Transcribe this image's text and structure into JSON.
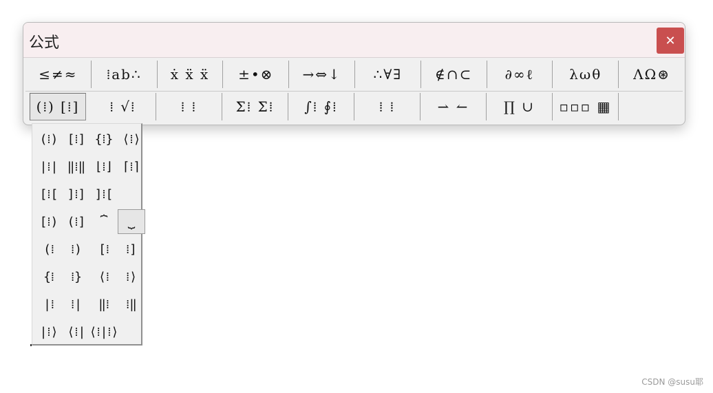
{
  "window": {
    "title": "公式",
    "close_label": "✕"
  },
  "toolbar": {
    "row1": [
      {
        "name": "relations-palette",
        "label": "≤≠≈"
      },
      {
        "name": "spaces-ellipses-palette",
        "label": "⁞ab∴"
      },
      {
        "name": "embellishments-palette",
        "label": "ẋ ẍ ẍ"
      },
      {
        "name": "operators-palette",
        "label": "±•⊗"
      },
      {
        "name": "arrows-palette",
        "label": "→⇔↓"
      },
      {
        "name": "logic-palette",
        "label": "∴∀∃"
      },
      {
        "name": "set-theory-palette",
        "label": "∉∩⊂"
      },
      {
        "name": "misc-symbols-palette",
        "label": "∂∞ℓ"
      },
      {
        "name": "greek-lower-palette",
        "label": "λωθ"
      },
      {
        "name": "greek-upper-palette",
        "label": "ΛΩ⊛"
      }
    ],
    "row2": [
      {
        "name": "fences-templates",
        "label": "(⁞) [⁞]",
        "pressed": true
      },
      {
        "name": "fraction-radical-templates",
        "label": "⁞ √⁞"
      },
      {
        "name": "script-templates",
        "label": "⁞ ⁞"
      },
      {
        "name": "summation-templates",
        "label": "Σ⁞ Σ⁞"
      },
      {
        "name": "integral-templates",
        "label": "∫⁞ ∮⁞"
      },
      {
        "name": "bar-templates",
        "label": "⁞ ⁞"
      },
      {
        "name": "labeled-arrow-templates",
        "label": "⇀ ↼"
      },
      {
        "name": "products-templates",
        "label": "∏ ∪"
      },
      {
        "name": "matrix-templates",
        "label": "▫▫▫ ▦"
      }
    ]
  },
  "dropdown": {
    "rows": [
      [
        "(⁞)",
        "[⁞]",
        "{⁞}",
        "⟨⁞⟩"
      ],
      [
        "|⁞|",
        "‖⁞‖",
        "⌊⁞⌋",
        "⌈⁞⌉"
      ],
      [
        "[⁞[",
        "]⁞]",
        "]⁞[",
        ""
      ],
      [
        "[⁞)",
        "(⁞]",
        "⏞",
        "⏟"
      ],
      [
        "(⁞",
        "⁞)",
        "[⁞",
        "⁞]"
      ],
      [
        "{⁞",
        "⁞}",
        "⟨⁞",
        "⁞⟩"
      ],
      [
        "|⁞",
        "⁞|",
        "‖⁞",
        "⁞‖"
      ],
      [
        "|⁞⟩",
        "⟨⁞|",
        "⟨⁞|⁞⟩",
        ""
      ]
    ]
  },
  "watermark": "CSDN @susu耶"
}
